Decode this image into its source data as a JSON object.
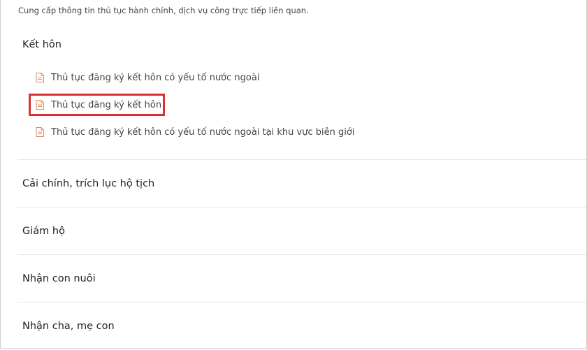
{
  "intro_text": "Cung cấp thông tin thủ tục hành chính, dịch vụ công trực tiếp liên quan.",
  "section": {
    "title": "Kết hôn",
    "items": [
      {
        "label": "Thủ tục đăng ký kết hôn có yếu tố nước ngoài",
        "icon": "document-icon"
      },
      {
        "label": "Thủ tục đăng ký kết hôn",
        "icon": "document-icon",
        "highlighted": true
      },
      {
        "label": "Thủ tục đăng ký kết hôn có yếu tố nước ngoài tại khu vực biên giới",
        "icon": "document-icon"
      }
    ]
  },
  "categories": [
    {
      "label": "Cải chính, trích lục hộ tịch"
    },
    {
      "label": "Giám hộ"
    },
    {
      "label": "Nhận con nuôi"
    },
    {
      "label": "Nhận cha, mẹ con"
    }
  ],
  "colors": {
    "highlight_border": "#d93035",
    "icon": "#e08a5a",
    "divider": "#e6e6e6"
  }
}
